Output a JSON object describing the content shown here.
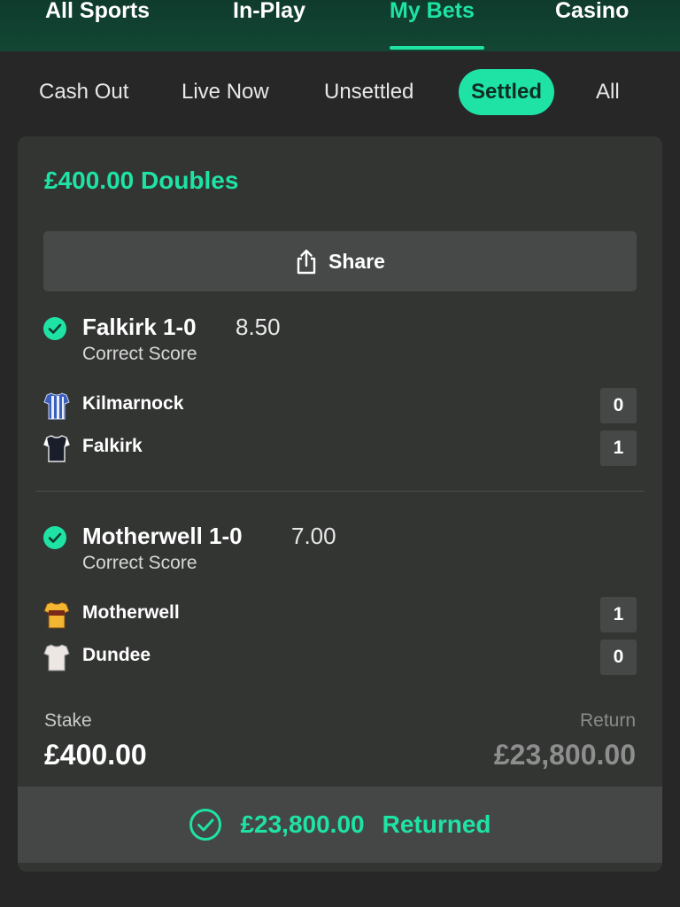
{
  "nav": {
    "tabs": [
      {
        "label": "All Sports"
      },
      {
        "label": "In-Play"
      },
      {
        "label": "My Bets",
        "active": true
      },
      {
        "label": "Casino"
      }
    ]
  },
  "filters": {
    "items": [
      {
        "label": "Cash Out"
      },
      {
        "label": "Live Now"
      },
      {
        "label": "Unsettled"
      },
      {
        "label": "Settled",
        "active": true
      },
      {
        "label": "All"
      }
    ]
  },
  "bet": {
    "title": "£400.00 Doubles",
    "share_label": "Share",
    "selections": [
      {
        "name": "Falkirk 1-0",
        "odds": "8.50",
        "market": "Correct Score",
        "status_icon": "check-circle-icon",
        "teams": [
          {
            "name": "Kilmarnock",
            "score": "0",
            "shirt_icon": "kilmarnock-shirt-icon"
          },
          {
            "name": "Falkirk",
            "score": "1",
            "shirt_icon": "falkirk-shirt-icon"
          }
        ]
      },
      {
        "name": "Motherwell 1-0",
        "odds": "7.00",
        "market": "Correct Score",
        "status_icon": "check-circle-icon",
        "teams": [
          {
            "name": "Motherwell",
            "score": "1",
            "shirt_icon": "motherwell-shirt-icon"
          },
          {
            "name": "Dundee",
            "score": "0",
            "shirt_icon": "dundee-shirt-icon"
          }
        ]
      }
    ],
    "stake_label": "Stake",
    "stake_value": "£400.00",
    "return_label": "Return",
    "return_value": "£23,800.00",
    "returned_amount": "£23,800.00",
    "returned_label": "Returned"
  },
  "colors": {
    "accent": "#1ee3a5",
    "background": "#272727",
    "card": "#333533",
    "nav": "#134734"
  }
}
